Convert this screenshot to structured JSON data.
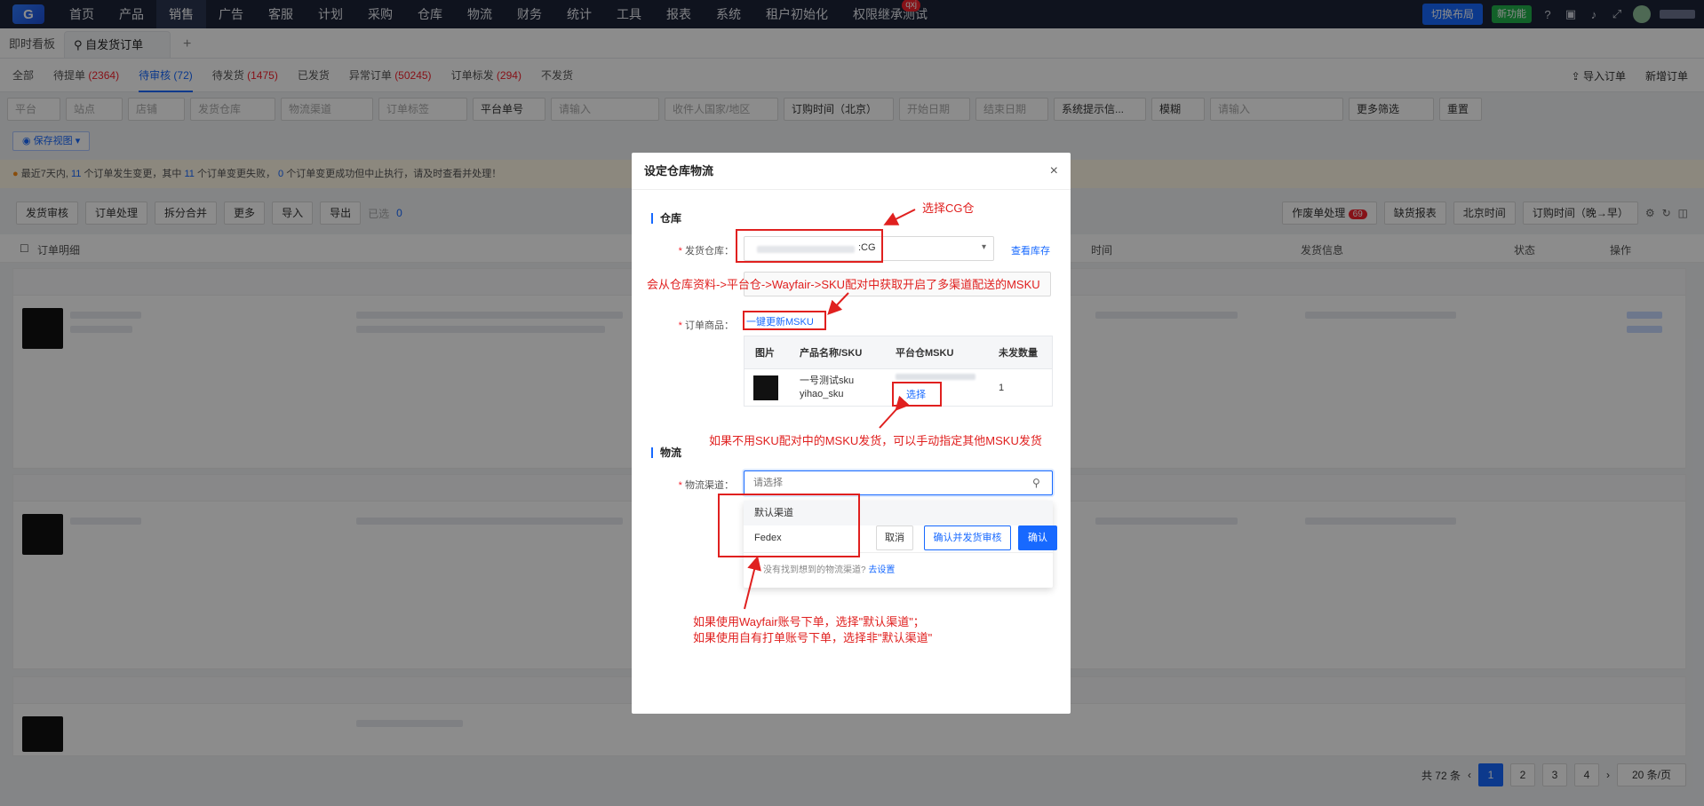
{
  "topnav": {
    "logo": "G",
    "items": [
      "首页",
      "产品",
      "销售",
      "广告",
      "客服",
      "计划",
      "采购",
      "仓库",
      "物流",
      "财务",
      "统计",
      "工具",
      "报表",
      "系统",
      "租户初始化",
      "权限继承测试"
    ],
    "active_index": 2,
    "badge": "qxj",
    "switch_layout": "切换布局",
    "new_feature": "新功能"
  },
  "page_tabs": {
    "dashboard": "即时看板",
    "current": "自发货订单",
    "add": "+"
  },
  "status_tabs": [
    {
      "label": "全部",
      "count": ""
    },
    {
      "label": "待提单",
      "count": "(2364)"
    },
    {
      "label": "待审核",
      "count": "(72)"
    },
    {
      "label": "待发货",
      "count": "(1475)"
    },
    {
      "label": "已发货",
      "count": ""
    },
    {
      "label": "异常订单",
      "count": "(50245)"
    },
    {
      "label": "订单标发",
      "count": "(294)"
    },
    {
      "label": "不发货",
      "count": ""
    }
  ],
  "status_actions": {
    "import": "导入订单",
    "new": "新增订单"
  },
  "filters": [
    "平台",
    "站点",
    "店铺",
    "发货仓库",
    "物流渠道",
    "订单标签",
    "平台单号",
    "请输入",
    "收件人国家/地区",
    "订购时间（北京）",
    "开始日期",
    "结束日期",
    "系统提示信...",
    "模糊",
    "请输入",
    "更多筛选",
    "重置"
  ],
  "save_view": "保存视图",
  "notice": {
    "prefix": "最近7天内,",
    "n1": "11",
    "t1": "个订单发生变更，其中",
    "n2": "11",
    "t2": "个订单变更失败，",
    "n3": "0",
    "t3": "个订单变更成功但中止执行，请及时查看并处理！"
  },
  "toolbar": {
    "left": [
      "发货审核",
      "订单处理",
      "拆分合并",
      "更多",
      "导入",
      "导出"
    ],
    "selected": "已选",
    "selected_count": "0",
    "right_work": "作废单处理",
    "right_work_count": "69",
    "report": "缺货报表",
    "tz": "北京时间",
    "sort": "订购时间（晚→早）"
  },
  "table_head": {
    "date": "订单明细",
    "time": "时间",
    "ship": "发货信息",
    "status": "状态",
    "op": "操作"
  },
  "pagination": {
    "total": "共 72 条",
    "pages": [
      "1",
      "2",
      "3",
      "4"
    ],
    "current": "1",
    "page_size": "20 条/页",
    "prev": "‹",
    "next": "›"
  },
  "modal": {
    "title": "设定仓库物流",
    "close": "×",
    "sec_warehouse": "仓库",
    "warehouse_label": "发货仓库：",
    "warehouse_value": ":CG",
    "view_stock": "查看库存",
    "order_items_label": "订单商品：",
    "update_msku": "一键更新MSKU",
    "sku_headers": [
      "图片",
      "产品名称/SKU",
      "平台仓MSKU",
      "未发数量"
    ],
    "sku_row": {
      "name": "一号测试sku",
      "sku": "yihao_sku",
      "choose": "选择",
      "qty": "1"
    },
    "sec_logistics": "物流",
    "logistics_label": "物流渠道：",
    "logistics_placeholder": "请选择",
    "options": [
      "默认渠道",
      "Fedex"
    ],
    "not_found": "没有找到想到的物流渠道?",
    "go_setting": "去设置",
    "btn_cancel": "取消",
    "btn_confirm_ship": "确认并发货审核",
    "btn_confirm": "确认"
  },
  "annotations": {
    "a1": "选择CG仓",
    "a2": "会从仓库资料->平台仓->Wayfair->SKU配对中获取开启了多渠道配送的MSKU",
    "a3": "如果不用SKU配对中的MSKU发货，可以手动指定其他MSKU发货",
    "a4_line1": "如果使用Wayfair账号下单，选择\"默认渠道\"；",
    "a4_line2": "如果使用自有打单账号下单，选择非\"默认渠道\""
  },
  "colors": {
    "primary": "#1769ff",
    "annotation": "#e0201f",
    "topbar": "#1c2438"
  }
}
